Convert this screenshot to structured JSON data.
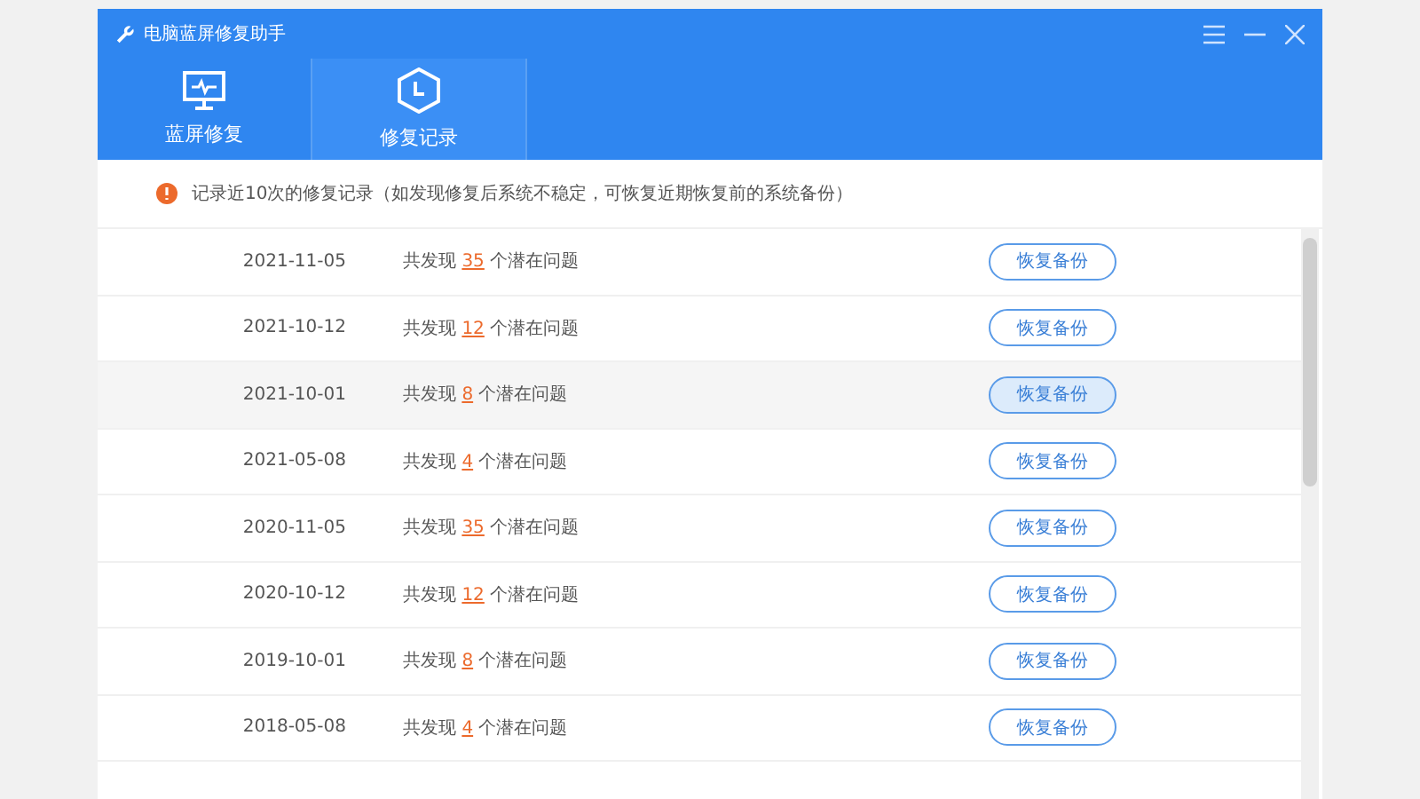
{
  "window": {
    "title": "电脑蓝屏修复助手"
  },
  "tabs": [
    {
      "label": "蓝屏修复",
      "kind": "monitor",
      "selected": false
    },
    {
      "label": "修复记录",
      "kind": "clock",
      "selected": true
    }
  ],
  "notice": "记录近10次的修复记录（如发现修复后系统不稳定，可恢复近期恢复前的系统备份）",
  "records": [
    {
      "date": "2021-11-05",
      "prefix": "共发现",
      "count": "35",
      "suffix": "个潜在问题",
      "button": "恢复备份",
      "hovered": false
    },
    {
      "date": "2021-10-12",
      "prefix": "共发现",
      "count": "12",
      "suffix": "个潜在问题",
      "button": "恢复备份",
      "hovered": false
    },
    {
      "date": "2021-10-01",
      "prefix": "共发现",
      "count": "8",
      "suffix": "个潜在问题",
      "button": "恢复备份",
      "hovered": true
    },
    {
      "date": "2021-05-08",
      "prefix": "共发现",
      "count": "4",
      "suffix": "个潜在问题",
      "button": "恢复备份",
      "hovered": false
    },
    {
      "date": "2020-11-05",
      "prefix": "共发现",
      "count": "35",
      "suffix": "个潜在问题",
      "button": "恢复备份",
      "hovered": false
    },
    {
      "date": "2020-10-12",
      "prefix": "共发现",
      "count": "12",
      "suffix": "个潜在问题",
      "button": "恢复备份",
      "hovered": false
    },
    {
      "date": "2019-10-01",
      "prefix": "共发现",
      "count": "8",
      "suffix": "个潜在问题",
      "button": "恢复备份",
      "hovered": false
    },
    {
      "date": "2018-05-08",
      "prefix": "共发现",
      "count": "4",
      "suffix": "个潜在问题",
      "button": "恢复备份",
      "hovered": false
    }
  ]
}
